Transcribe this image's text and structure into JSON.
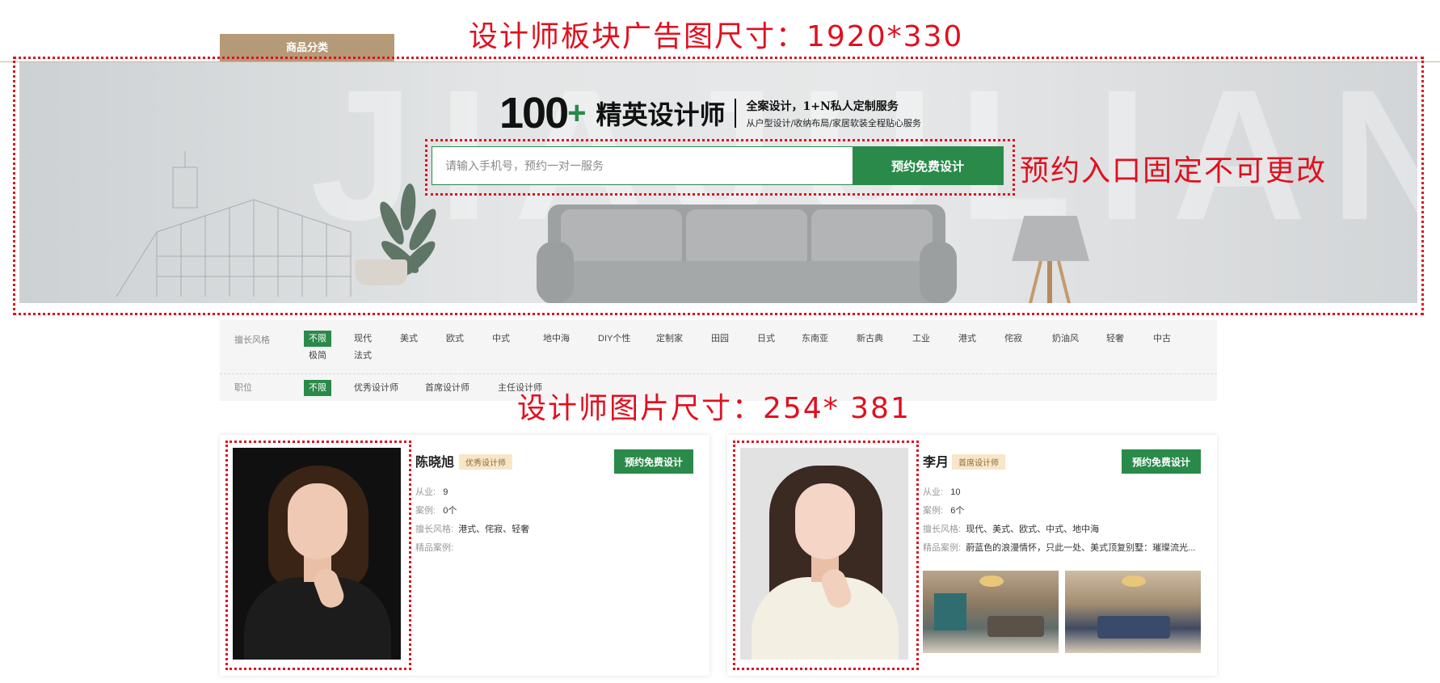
{
  "top": {
    "category_tab": "商品分类"
  },
  "notes": {
    "banner_size": "设计师板块广告图尺寸：1920*330",
    "reserve_fixed": "预约入口固定不可更改",
    "photo_size": "设计师图片尺寸：254* 381"
  },
  "banner": {
    "watermark": "JIAJULIANG",
    "headline_number": "100",
    "headline_plus": "+",
    "headline_title": "精英设计师",
    "subline1": "全案设计，1+N私人定制服务",
    "subline2": "从户型设计/收纳布局/家居软装全程贴心服务",
    "search": {
      "placeholder": "请输入手机号，预约一对一服务",
      "button_label": "预约免费设计"
    }
  },
  "filters": {
    "style": {
      "label": "擅长风格",
      "options": [
        "不限",
        "现代",
        "美式",
        "欧式",
        "中式",
        "地中海",
        "DIY个性",
        "定制家",
        "田园",
        "日式",
        "东南亚",
        "新古典",
        "工业",
        "港式",
        "侘寂",
        "奶油风",
        "轻奢",
        "中古",
        "极简",
        "法式"
      ],
      "selected": "不限"
    },
    "position": {
      "label": "职位",
      "options": [
        "不限",
        "优秀设计师",
        "首席设计师",
        "主任设计师"
      ],
      "selected": "不限"
    }
  },
  "designers": [
    {
      "name": "陈晓旭",
      "title": "优秀设计师",
      "button_label": "预约免费设计",
      "years_key": "从业:",
      "years": "9",
      "cases_key": "案例:",
      "cases": "0个",
      "styles_key": "擅长风格:",
      "styles": "港式、侘寂、轻奢",
      "featured_key": "精品案例:",
      "featured": ""
    },
    {
      "name": "李月",
      "title": "首席设计师",
      "button_label": "预约免费设计",
      "years_key": "从业:",
      "years": "10",
      "cases_key": "案例:",
      "cases": "6个",
      "styles_key": "擅长风格:",
      "styles": "现代、美式、欧式、中式、地中海",
      "featured_key": "精品案例:",
      "featured": "蔚蓝色的浪漫情怀，只此一处、美式顶复别墅：璀璨流光..."
    }
  ],
  "colors": {
    "accent_green": "#2a8a4a",
    "annotation_red": "#e0101f",
    "category_tab": "#b59a78"
  }
}
